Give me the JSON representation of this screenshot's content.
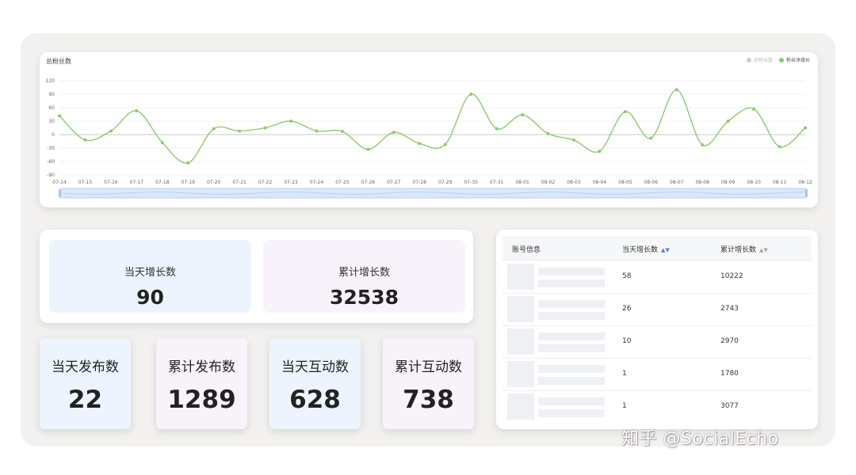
{
  "chart": {
    "title": "总粉丝数",
    "legend": [
      {
        "label": "总粉丝数",
        "color": "#cccccc"
      },
      {
        "label": "粉丝净增长",
        "color": "#8ccb6b"
      }
    ],
    "line_color": "#8ccb6b"
  },
  "chart_data": {
    "type": "line",
    "title": "总粉丝数",
    "x": [
      "07-14",
      "07-15",
      "07-16",
      "07-17",
      "07-18",
      "07-19",
      "07-20",
      "07-21",
      "07-22",
      "07-23",
      "07-24",
      "07-25",
      "07-26",
      "07-27",
      "07-28",
      "07-29",
      "07-30",
      "07-31",
      "08-01",
      "08-02",
      "08-03",
      "08-04",
      "08-05",
      "08-06",
      "08-07",
      "08-08",
      "08-09",
      "08-10",
      "08-11",
      "08-12"
    ],
    "ylim": [
      -90,
      120
    ],
    "yticks": [
      120,
      90,
      60,
      30,
      0,
      -30,
      -60,
      -90
    ],
    "grid": true,
    "legend_position": "top-right",
    "series": [
      {
        "name": "粉丝净增长",
        "values": [
          42,
          -12,
          8,
          53,
          -18,
          -63,
          13,
          8,
          15,
          30,
          8,
          7,
          -33,
          5,
          -20,
          -22,
          90,
          13,
          44,
          2,
          -12,
          -37,
          51,
          -8,
          100,
          -23,
          30,
          57,
          -27,
          15
        ]
      }
    ]
  },
  "stats": {
    "today_growth": {
      "label": "当天增长数",
      "value": "90"
    },
    "total_growth": {
      "label": "累计增长数",
      "value": "32538"
    }
  },
  "small_stats": [
    {
      "label": "当天发布数",
      "value": "22"
    },
    {
      "label": "累计发布数",
      "value": "1289"
    },
    {
      "label": "当天互动数",
      "value": "628"
    },
    {
      "label": "累计互动数",
      "value": "738"
    }
  ],
  "table": {
    "headers": [
      "账号信息",
      "当天增长数",
      "累计增长数"
    ],
    "rows": [
      {
        "today": "58",
        "total": "10222"
      },
      {
        "today": "26",
        "total": "2743"
      },
      {
        "today": "10",
        "total": "2970"
      },
      {
        "today": "1",
        "total": "1780"
      },
      {
        "today": "1",
        "total": "3077"
      }
    ]
  },
  "watermark": "知乎 @SocialEcho",
  "colors": {
    "box_blue": "#eef4fd",
    "box_pink": "#f8f3fb"
  }
}
